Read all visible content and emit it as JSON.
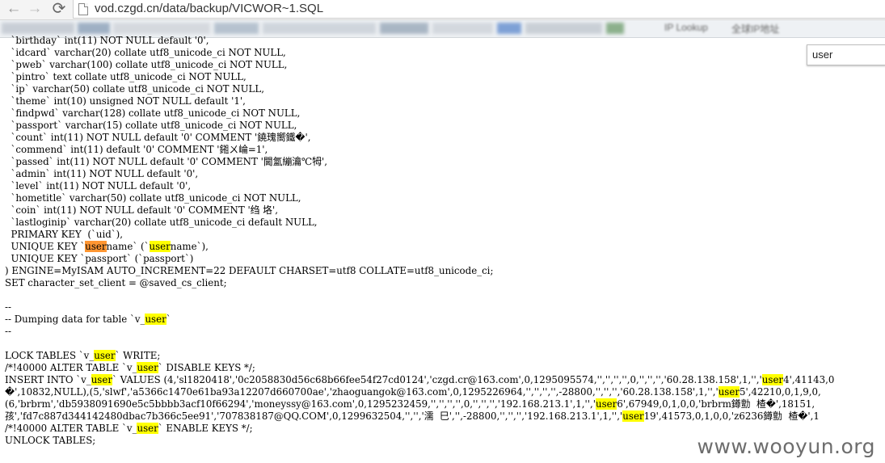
{
  "browser": {
    "url": "vod.czgd.cn/data/backup/VICWOR~1.SQL",
    "nav": {
      "back": "←",
      "forward": "→",
      "reload": "⟳"
    },
    "bookmarks_obscured": [
      "IP Lookup",
      "全球IP地址"
    ]
  },
  "find": {
    "query": "user"
  },
  "sql": {
    "lines": [
      [
        "  `birthday` int(11) NOT NULL default '0',"
      ],
      [
        "  `idcard` varchar(20) collate utf8_unicode_ci NOT NULL,"
      ],
      [
        "  `pweb` varchar(100) collate utf8_unicode_ci NOT NULL,"
      ],
      [
        "  `pintro` text collate utf8_unicode_ci NOT NULL,"
      ],
      [
        "  `ip` varchar(50) collate utf8_unicode_ci NOT NULL,"
      ],
      [
        "  `theme` int(10) unsigned NOT NULL default '1',"
      ],
      [
        "  `findpwd` varchar(128) collate utf8_unicode_ci NOT NULL,"
      ],
      [
        "  `passport` varchar(15) collate utf8_unicode_ci NOT NULL,"
      ],
      [
        "  `count` int(11) NOT NULL default '0' COMMENT '鐃瑰嚮鐵�',"
      ],
      [
        "  `commend` int(11) default '0' COMMENT '鎺ㄨ崘=1',"
      ],
      [
        "  `passed` int(11) NOT NULL default '0' COMMENT '閫氳繃瀹℃牳',"
      ],
      [
        "  `admin` int(11) NOT NULL default '0',"
      ],
      [
        "  `level` int(11) NOT NULL default '0',"
      ],
      [
        "  `hometitle` varchar(50) collate utf8_unicode_ci NOT NULL,"
      ],
      [
        "  `coin` int(11) NOT NULL default '0' COMMENT '绉 垎',"
      ],
      [
        "  `lastloginip` varchar(20) collate utf8_unicode_ci default NULL,"
      ],
      [
        "  PRIMARY KEY  (`uid`),"
      ],
      [
        "  UNIQUE KEY `",
        {
          "a": "user"
        },
        "name` (`",
        {
          "h": "user"
        },
        "name`),"
      ],
      [
        "  UNIQUE KEY `passport` (`passport`)"
      ],
      [
        ") ENGINE=MyISAM AUTO_INCREMENT=22 DEFAULT CHARSET=utf8 COLLATE=utf8_unicode_ci;"
      ],
      [
        "SET character_set_client = @saved_cs_client;"
      ],
      [
        ""
      ],
      [
        "--"
      ],
      [
        "-- Dumping data for table `v_",
        {
          "h": "user"
        },
        "`"
      ],
      [
        "--"
      ],
      [
        ""
      ],
      [
        "LOCK TABLES `v_",
        {
          "h": "user"
        },
        "` WRITE;"
      ],
      [
        "/*!40000 ALTER TABLE `v_",
        {
          "h": "user"
        },
        "` DISABLE KEYS */;"
      ],
      [
        "INSERT INTO `v_",
        {
          "h": "user"
        },
        "` VALUES (4,'sl1820418','0c2058830d56c68b66fee54f27cd0124','czgd.cr@163.com',0,1295095574,'','','','',0,'','','','60.28.138.158',1,'','",
        {
          "h": "user"
        },
        "4',41143,0"
      ],
      [
        "�',10832,NULL),(5,'slwf','a5366c1470e61ba93a12207d660700ae','zhaoguangok@163.com',0,1295226964,'','','','',-28800,'','','','60.28.138.158',1,'','",
        {
          "h": "user"
        },
        "5',42210,0,1,9,0,"
      ],
      [
        "(6,'brbrm','db5938091690e5c5bbbb3acf10f66294','moneyssy@163.com',0,1295232459,'','','','',0,'','','','192.168.213.1',1,'','",
        {
          "h": "user"
        },
        "6',67949,0,1,0,0,'brbrm鐏勯  楂�',18151,"
      ],
      [
        "孩','fd7c887d344142480dbac7b366c5ee91','707838187@QQ.COM',0,1299632504,'','','濡  巳','',-28800,'','','','192.168.213.1',1,'','",
        {
          "h": "user"
        },
        "19',41573,0,1,0,0,'z6236鐏勯  楂�',1"
      ],
      [
        "/*!40000 ALTER TABLE `v_",
        {
          "h": "user"
        },
        "` ENABLE KEYS */;"
      ],
      [
        "UNLOCK TABLES;"
      ]
    ]
  },
  "watermark": "www.wooyun.org"
}
